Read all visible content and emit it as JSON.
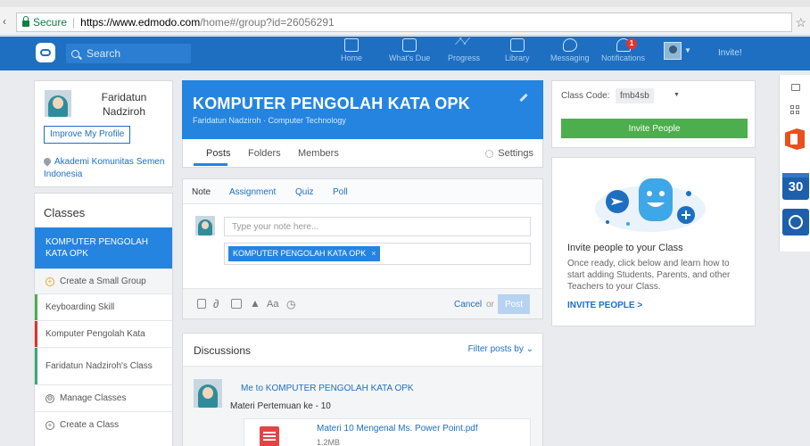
{
  "browser": {
    "secure_label": "Secure",
    "url_host": "https://www.edmodo.com",
    "url_path": "/home#/group?id=26056291"
  },
  "nav": {
    "search_placeholder": "Search",
    "items": [
      {
        "label": "Home",
        "icon": "home-icon"
      },
      {
        "label": "What's Due",
        "icon": "calendar-icon"
      },
      {
        "label": "Progress",
        "icon": "progress-icon"
      },
      {
        "label": "Library",
        "icon": "library-icon"
      },
      {
        "label": "Messaging",
        "icon": "message-icon"
      },
      {
        "label": "Notifications",
        "icon": "bell-icon"
      }
    ],
    "notification_count": "1",
    "invite_label": "Invite!"
  },
  "profile": {
    "name": "Faridatun Nadziroh",
    "improve_label": "Improve My Profile",
    "school": "Akademi Komunitas Semen Indonesia"
  },
  "classes": {
    "heading": "Classes",
    "active": "KOMPUTER PENGOLAH KATA OPK",
    "small_group": "Create a Small Group",
    "items": [
      {
        "label": "Keyboarding Skill",
        "color": "#4cae4c"
      },
      {
        "label": "Komputer Pengolah Kata",
        "color": "#d9342b"
      },
      {
        "label": "Faridatun Nadziroh's Class",
        "color": "#3aa876"
      }
    ],
    "manage": "Manage Classes",
    "create": "Create a Class"
  },
  "group": {
    "title": "KOMPUTER PENGOLAH KATA OPK",
    "subtitle": "Faridatun Nadziroh · Computer Technology",
    "tabs": [
      "Posts",
      "Folders",
      "Members"
    ],
    "settings_label": "Settings"
  },
  "composer": {
    "tabs": [
      "Note",
      "Assignment",
      "Quiz",
      "Poll"
    ],
    "note_placeholder": "Type your note here...",
    "recipient": "KOMPUTER PENGOLAH KATA OPK",
    "recipient_remove": "×",
    "font_label": "Aa",
    "cancel_label": "Cancel",
    "or_label": "or",
    "post_label": "Post"
  },
  "discussions": {
    "title": "Discussions",
    "filter_label": "Filter posts by",
    "post": {
      "header": "Me to KOMPUTER PENGOLAH KATA OPK",
      "body": "Materi Pertemuan ke - 10",
      "attachment_name": "Materi 10 Mengenal Ms. Power Point.pdf",
      "attachment_size": "1.2MB"
    }
  },
  "class_code": {
    "label": "Class Code:",
    "code": "fmb4sb",
    "invite_button": "Invite People"
  },
  "invite_card": {
    "title": "Invite people to your Class",
    "description": "Once ready, click below and learn how to start adding Students, Parents, and other Teachers to your Class.",
    "link": "INVITE PEOPLE >"
  },
  "side_strip": {
    "calendar_day": "30"
  }
}
